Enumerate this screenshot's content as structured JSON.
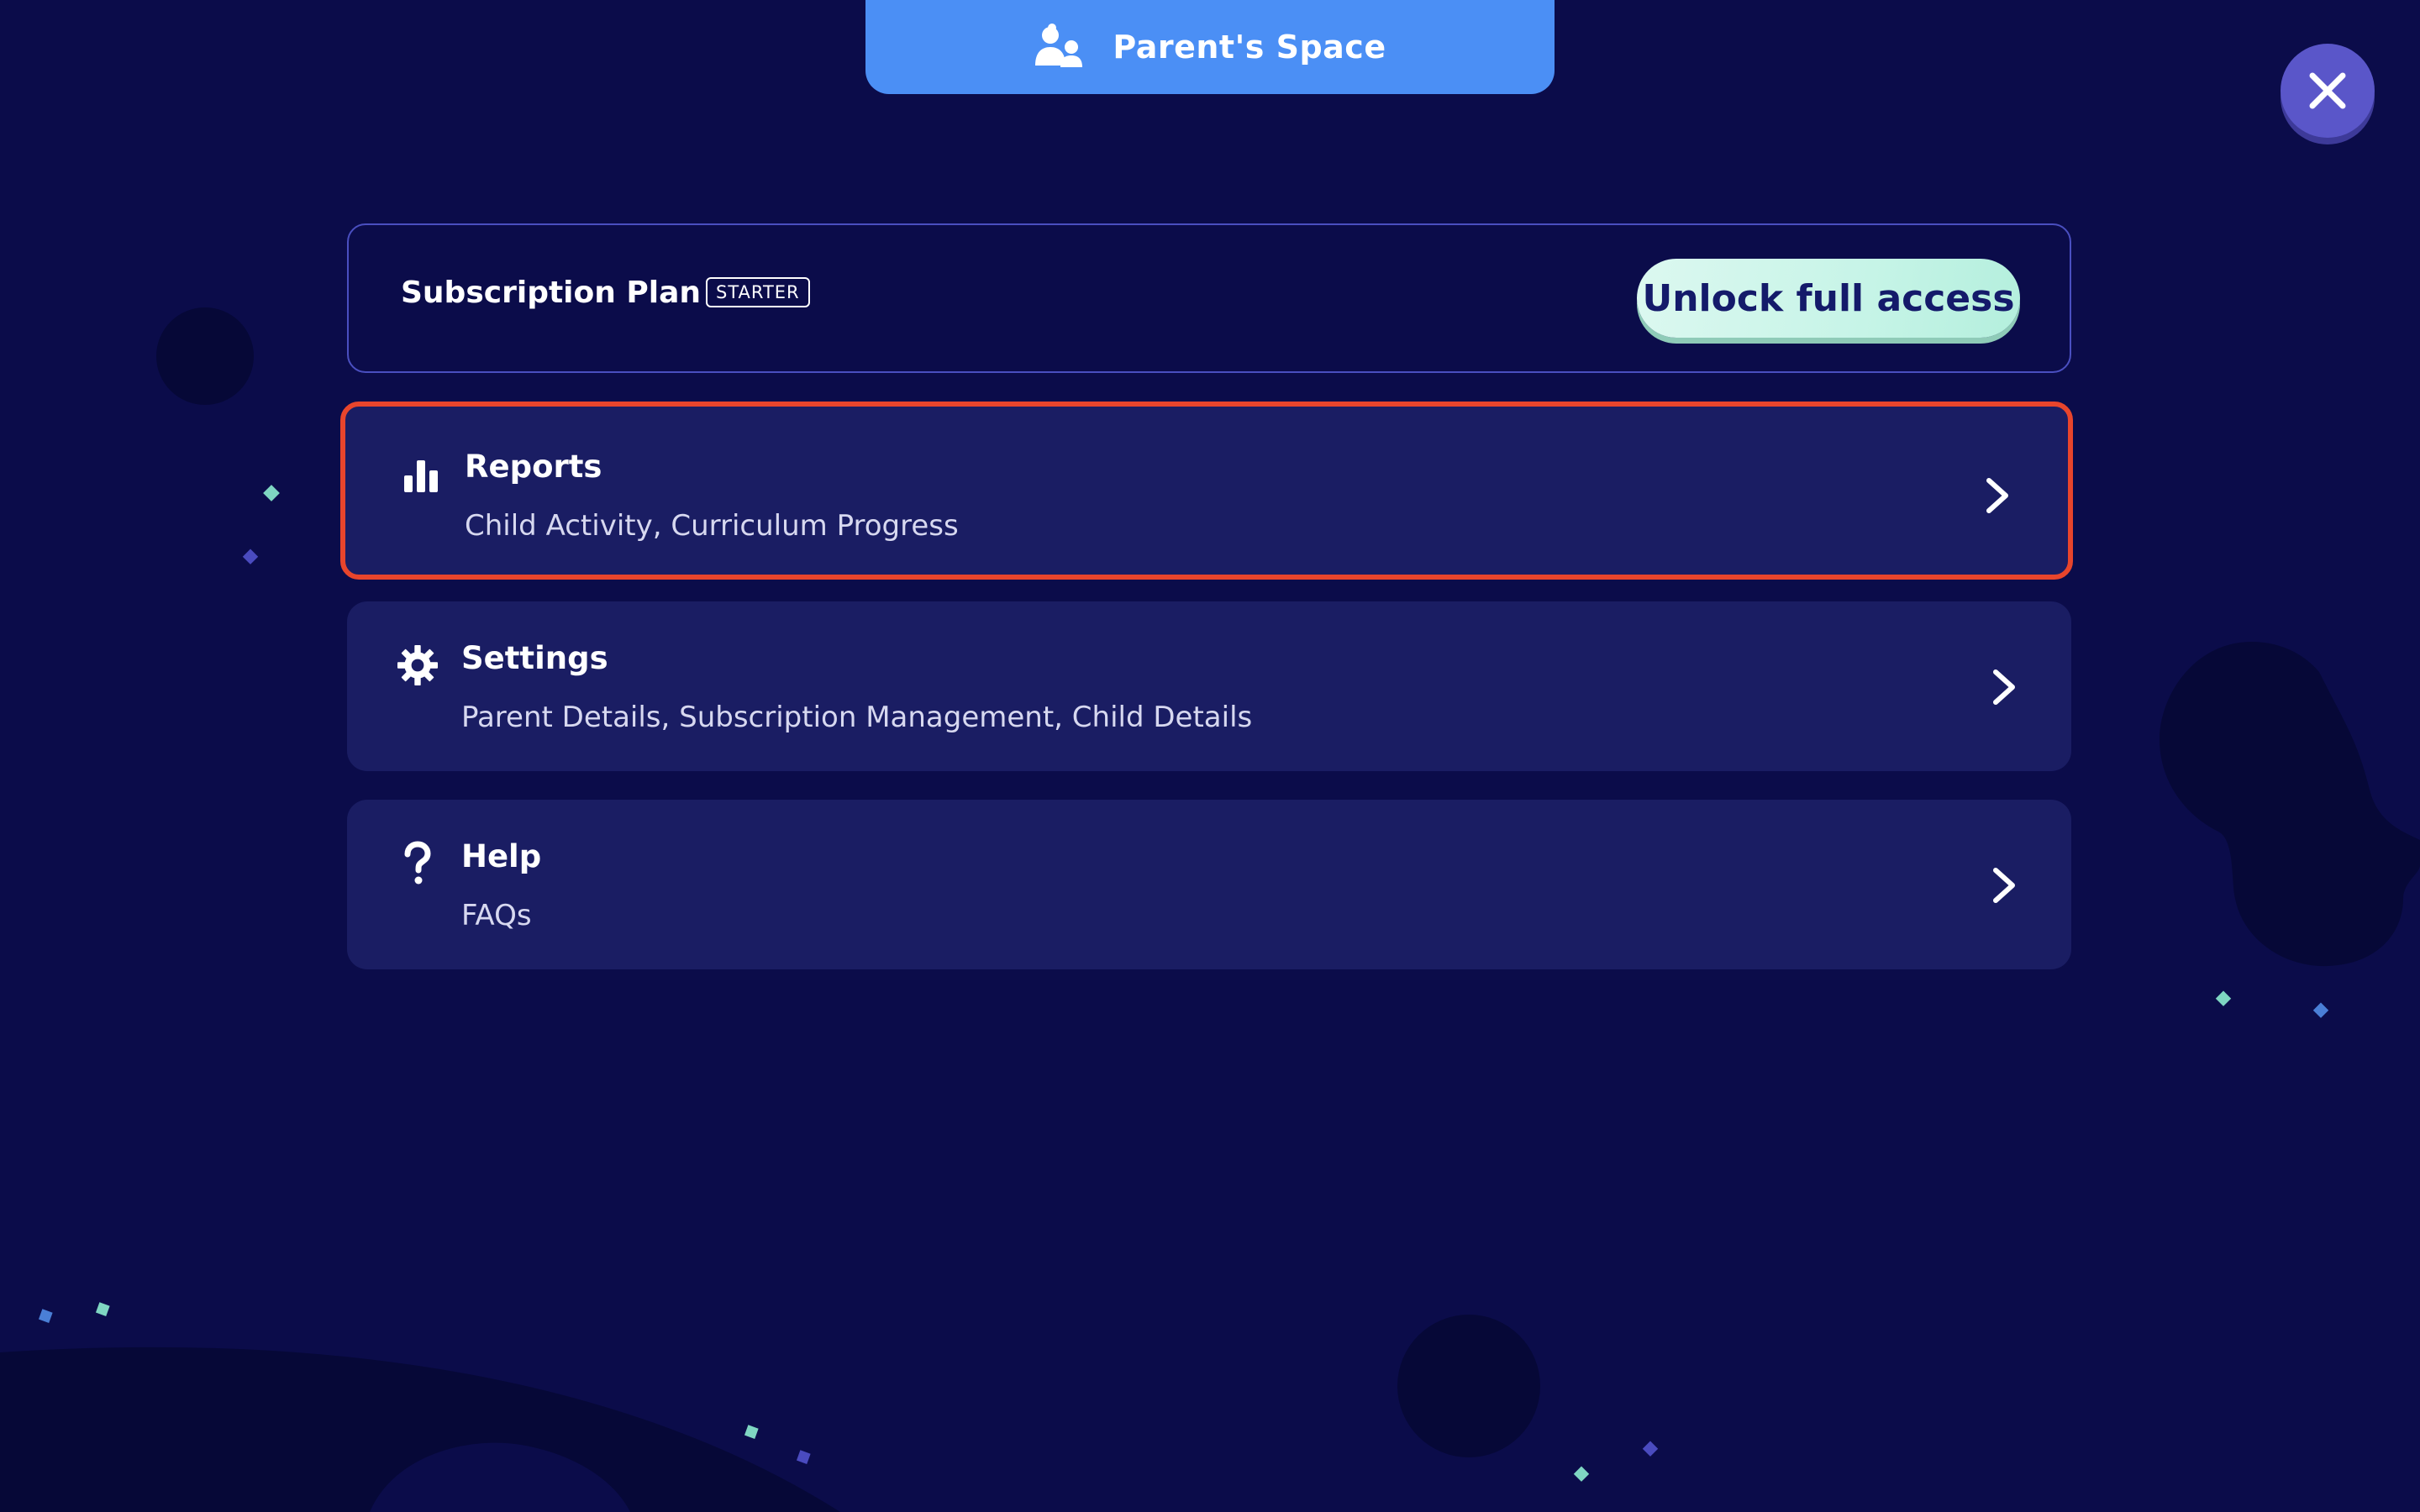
{
  "header": {
    "title": "Parent's Space",
    "icon": "parent-child-icon"
  },
  "close": {
    "icon": "close-icon"
  },
  "subscription": {
    "label": "Subscription Plan",
    "plan_badge": "STARTER",
    "cta_label": "Unlock full access"
  },
  "menu": {
    "items": [
      {
        "title": "Reports",
        "subtitle": "Child Activity, Curriculum Progress",
        "icon": "bar-chart-icon",
        "selected": true
      },
      {
        "title": "Settings",
        "subtitle": "Parent Details, Subscription Management, Child Details",
        "icon": "gear-icon",
        "selected": false
      },
      {
        "title": "Help",
        "subtitle": "FAQs",
        "icon": "question-mark-icon",
        "selected": false
      }
    ]
  },
  "colors": {
    "background": "#0b0c4a",
    "header_tab": "#4b8ff5",
    "card": "#1a1d63",
    "selection_outline": "#e8452c",
    "cta": "#c6f4e7",
    "close_button": "#5a56c9"
  }
}
